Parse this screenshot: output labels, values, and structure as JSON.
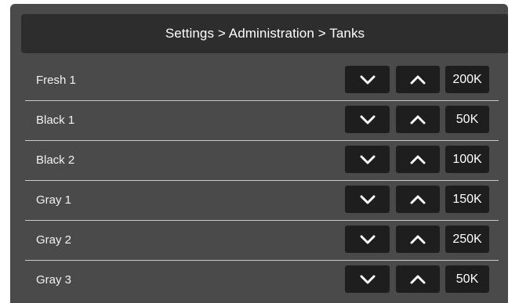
{
  "header": {
    "breadcrumb": "Settings > Administration > Tanks"
  },
  "icons": {
    "decrease": "chevron-down-icon",
    "increase": "chevron-up-icon"
  },
  "tanks": [
    {
      "label": "Fresh 1",
      "value": "200K"
    },
    {
      "label": "Black 1",
      "value": "50K"
    },
    {
      "label": "Black 2",
      "value": "100K"
    },
    {
      "label": "Gray 1",
      "value": "150K"
    },
    {
      "label": "Gray 2",
      "value": "250K"
    },
    {
      "label": "Gray 3",
      "value": "50K"
    }
  ],
  "colors": {
    "panel": "#4a4a4a",
    "header": "#2d2d2d",
    "button": "#1e1e1e",
    "text": "#ffffff"
  }
}
